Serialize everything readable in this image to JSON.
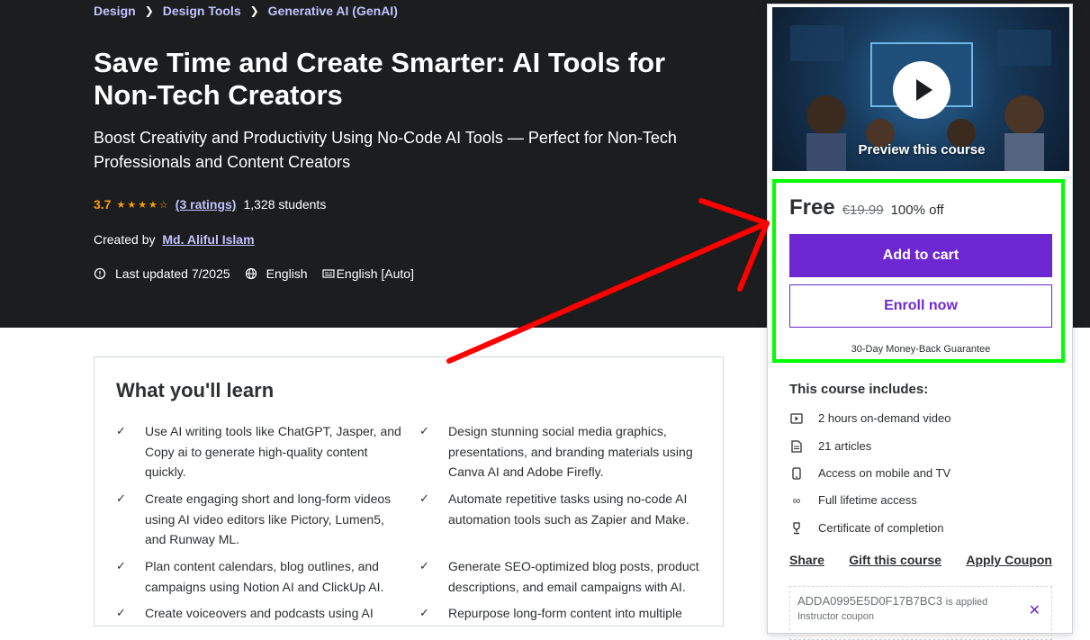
{
  "breadcrumb": [
    "Design",
    "Design Tools",
    "Generative AI (GenAI)"
  ],
  "course": {
    "title": "Save Time and Create Smarter: AI Tools for Non-Tech Creators",
    "subtitle": "Boost Creativity and Productivity Using No-Code AI Tools — Perfect for Non-Tech Professionals and Content Creators",
    "rating": "3.7",
    "rating_value": 3.7,
    "ratings_link": "(3 ratings)",
    "students": "1,328 students",
    "created_by_label": "Created by",
    "author": "Md. Aliful Islam",
    "last_updated": "Last updated 7/2025",
    "language": "English",
    "captions": "English [Auto]"
  },
  "learn": {
    "title": "What you'll learn",
    "items": [
      "Use AI writing tools like ChatGPT, Jasper, and Copy ai to generate high-quality content quickly.",
      "Design stunning social media graphics, presentations, and branding materials using Canva AI and Adobe Firefly.",
      "Create engaging short and long-form videos using AI video editors like Pictory, Lumen5, and Runway ML.",
      "Automate repetitive tasks using no-code AI automation tools such as Zapier and Make.",
      "Plan content calendars, blog outlines, and campaigns using Notion AI and ClickUp AI.",
      "Generate SEO-optimized blog posts, product descriptions, and email campaigns with AI.",
      "Create voiceovers and podcasts using AI",
      "Repurpose long-form content into multiple"
    ]
  },
  "card": {
    "preview_label": "Preview this course",
    "price": "Free",
    "old_price": "€19.99",
    "discount": "100% off",
    "add_to_cart": "Add to cart",
    "enroll_now": "Enroll now",
    "guarantee": "30-Day Money-Back Guarantee",
    "includes_title": "This course includes:",
    "includes": [
      {
        "icon": "video-icon",
        "label": "2 hours on-demand video"
      },
      {
        "icon": "article-icon",
        "label": "21 articles"
      },
      {
        "icon": "mobile-icon",
        "label": "Access on mobile and TV"
      },
      {
        "icon": "infinity-icon",
        "label": "Full lifetime access"
      },
      {
        "icon": "trophy-icon",
        "label": "Certificate of completion"
      }
    ],
    "links": {
      "share": "Share",
      "gift": "Gift this course",
      "coupon": "Apply Coupon"
    },
    "coupon_code": "ADDA0995E5D0F17B7BC3",
    "coupon_applied": "is applied",
    "coupon_type": "Instructor coupon"
  },
  "colors": {
    "hero_bg": "#1c1d1f",
    "accent_purple": "#6d28d2",
    "link_lavender": "#c0c4fc",
    "star": "#f69c08",
    "highlight_green": "#00ff00",
    "annotation_red": "#ff0000"
  }
}
